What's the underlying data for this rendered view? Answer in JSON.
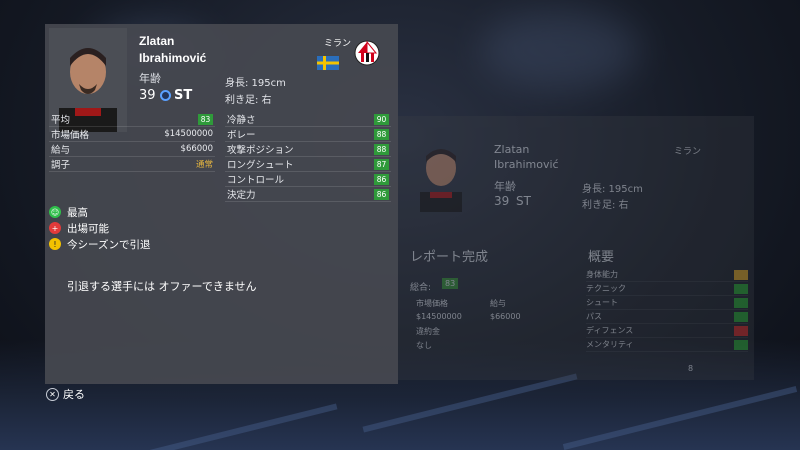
{
  "player": {
    "first_name": "Zlatan",
    "last_name": "Ibrahimović",
    "age_label": "年齢",
    "age": "39",
    "position": "ST",
    "club_name": "ミラン",
    "height": "身長: 195cm",
    "foot": "利き足: 右"
  },
  "stats_left": [
    {
      "label": "平均",
      "value": "83",
      "style": "badge"
    },
    {
      "label": "市場価格",
      "value": "$14500000",
      "style": "text"
    },
    {
      "label": "給与",
      "value": "$66000",
      "style": "text"
    },
    {
      "label": "調子",
      "value": "通常",
      "style": "yellow"
    }
  ],
  "stats_right": [
    {
      "label": "冷静さ",
      "value": "90"
    },
    {
      "label": "ボレー",
      "value": "88"
    },
    {
      "label": "攻撃ポジション",
      "value": "88"
    },
    {
      "label": "ロングシュート",
      "value": "87"
    },
    {
      "label": "コントロール",
      "value": "86"
    },
    {
      "label": "決定力",
      "value": "86"
    }
  ],
  "status": [
    {
      "label": "最高",
      "icon": "smile-icon",
      "color": "#2fbf4a"
    },
    {
      "label": "出場可能",
      "icon": "medical-icon",
      "color": "#e23a3a"
    },
    {
      "label": "今シーズンで引退",
      "icon": "warning-icon",
      "color": "#f2c200"
    }
  ],
  "message": "引退する選手には オファーできません",
  "back_label": "戻る",
  "ghost": {
    "first_name": "Zlatan",
    "last_name": "Ibrahimović",
    "age_label": "年齢",
    "age": "39",
    "position": "ST",
    "club_name": "ミラン",
    "height": "身長: 195cm",
    "foot": "利き足: 右",
    "report_title": "レポート完成",
    "summary_title": "概要",
    "overall_label": "総合:",
    "overall_value": "83",
    "market_label": "市場価格",
    "wage_label": "給与",
    "market_value": "$14500000",
    "wage_value": "$66000",
    "release_label": "違約金",
    "release_value": "なし",
    "attributes": [
      {
        "label": "身体能力",
        "color": "#c89a2e"
      },
      {
        "label": "テクニック",
        "color": "#2f9a3a"
      },
      {
        "label": "シュート",
        "color": "#2f9a3a"
      },
      {
        "label": "パス",
        "color": "#2f9a3a"
      },
      {
        "label": "ディフェンス",
        "color": "#c03030"
      },
      {
        "label": "メンタリティ",
        "color": "#2f9a3a"
      }
    ],
    "page_indicator": "8"
  },
  "colors": {
    "card_bg": "#464950",
    "badge_green": "#2f9a3a",
    "accent_yellow": "#e4b540",
    "position_blue": "#5aa0ff"
  }
}
